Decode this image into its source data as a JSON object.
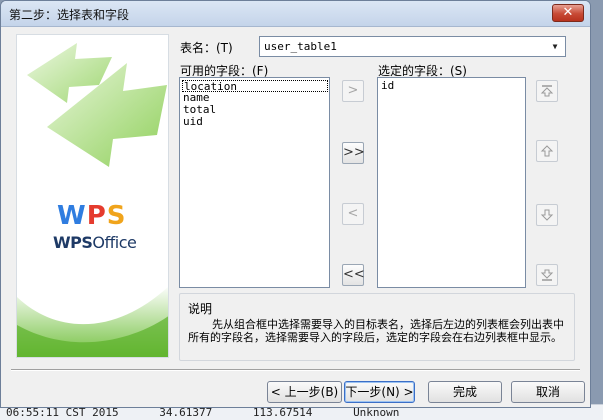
{
  "dialog": {
    "title": "第二步：选择表和字段",
    "close_symbol": "✕"
  },
  "logo": {
    "mark_w": "W",
    "mark_p": "P",
    "mark_s": "S",
    "office_prefix": "WPS",
    "office_suffix": "Office",
    "colors": {
      "w": "#2f7de0",
      "p": "#e53b2e",
      "s": "#f0a41c",
      "swoosh": "#7cc04a"
    }
  },
  "table": {
    "label": "表名：(T)",
    "selected": "user_table1"
  },
  "available_fields": {
    "label": "可用的字段：(F)",
    "items": [
      "location",
      "name",
      "total",
      "uid"
    ]
  },
  "selected_fields": {
    "label": "选定的字段：(S)",
    "items": [
      "id"
    ]
  },
  "transfer_buttons": {
    "add_one": ">",
    "add_all": ">>",
    "remove_one": "<",
    "remove_all": "<<"
  },
  "order_buttons": [
    "top-icon",
    "up-icon",
    "down-icon",
    "bottom-icon"
  ],
  "description": {
    "title": "说明",
    "text": "先从组合框中选择需要导入的目标表名，选择后左边的列表框会列出表中所有的字段名，选择需要导入的字段后，选定的字段会在右边列表框中显示。"
  },
  "footer": {
    "prev": "< 上一步(B)",
    "next": "下一步(N) >",
    "finish": "完成",
    "cancel": "取消"
  },
  "background_text": [
    "06:55:11 CST 2015",
    "34.61377",
    "113.67514",
    "Unknown"
  ]
}
